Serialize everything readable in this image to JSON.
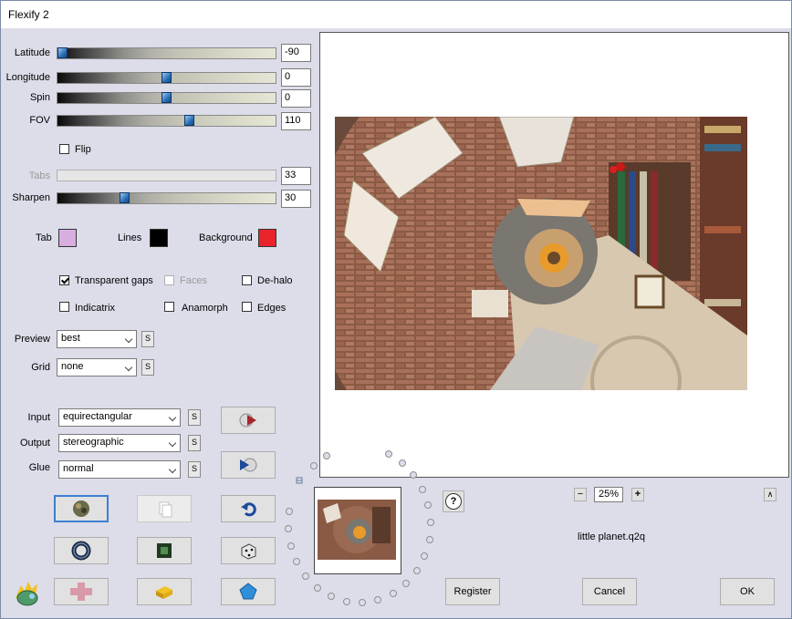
{
  "window": {
    "title": "Flexify 2"
  },
  "sliders": [
    {
      "label": "Latitude",
      "value": "-90",
      "level": 0.0
    },
    {
      "label": "Longitude",
      "value": "0",
      "level": 0.5
    },
    {
      "label": "Spin",
      "value": "0",
      "level": 0.5
    },
    {
      "label": "FOV",
      "value": "110",
      "level": 0.61
    },
    {
      "label": "Tabs",
      "value": "33",
      "level": null,
      "disabled": true
    },
    {
      "label": "Sharpen",
      "value": "30",
      "level": 0.3
    }
  ],
  "flip": {
    "label": "Flip",
    "checked": false
  },
  "colors": {
    "tab_label": "Tab",
    "tab_color": "#d8aee0",
    "lines_label": "Lines",
    "lines_color": "#000000",
    "background_label": "Background",
    "background_color": "#e8242a"
  },
  "options": {
    "transparent_gaps": {
      "label": "Transparent gaps",
      "checked": true
    },
    "faces": {
      "label": "Faces",
      "checked": false,
      "disabled": true
    },
    "de_halo": {
      "label": "De-halo",
      "checked": false
    },
    "indicatrix": {
      "label": "Indicatrix",
      "checked": false
    },
    "anamorph": {
      "label": "Anamorph",
      "checked": false
    },
    "edges": {
      "label": "Edges",
      "checked": false
    }
  },
  "preview_setting": {
    "label": "Preview",
    "value": "best"
  },
  "grid_setting": {
    "label": "Grid",
    "value": "none"
  },
  "input_setting": {
    "label": "Input",
    "value": "equirectangular"
  },
  "output_setting": {
    "label": "Output",
    "value": "stereographic"
  },
  "glue_setting": {
    "label": "Glue",
    "value": "normal"
  },
  "small_button_label": "S",
  "zoom": {
    "minus": "−",
    "value": "25%",
    "plus": "+"
  },
  "help_label": "?",
  "collapse_label": "∧",
  "preset_name": "little planet.q2q",
  "buttons": {
    "register": "Register",
    "cancel": "Cancel",
    "ok": "OK"
  }
}
